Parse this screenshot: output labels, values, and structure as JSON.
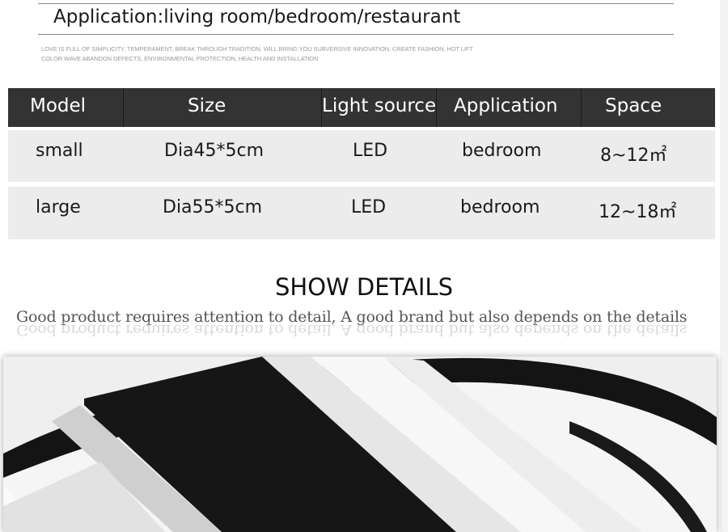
{
  "header": {
    "application_line": "Application:living room/bedroom/restaurant",
    "tagline_line1": "LOVE IS FULL OF SIMPLICITY, TEMPERAMENT, BREAK THROUGH TRADITION, WILL BRING YOU SUBVERSIVE INNOVATION, CREATE FASHION, HOT LIFT",
    "tagline_line2": "COLOR WAVE ABANDON DEFECTS, ENVIRONMENTAL PROTECTION, HEALTH AND INSTALLATION"
  },
  "spec_table": {
    "columns": [
      "Model",
      "Size",
      "Light source",
      "Application",
      "Space"
    ],
    "rows": [
      {
        "model": "small",
        "size": "Dia45*5cm",
        "light": "LED",
        "application": "bedroom",
        "space": "8~12㎡"
      },
      {
        "model": "large",
        "size": "Dia55*5cm",
        "light": "LED",
        "application": "bedroom",
        "space": "12~18㎡"
      }
    ],
    "colors": {
      "header_bg": "#333333",
      "row_bg": "#ececec"
    }
  },
  "details": {
    "title": "SHOW DETAILS",
    "subtitle": "Good product requires attention to detail, A good brand but also depends on the details"
  }
}
